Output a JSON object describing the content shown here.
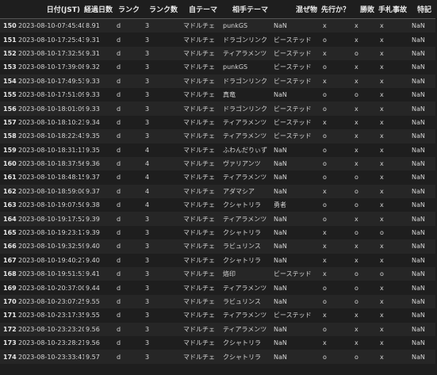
{
  "table": {
    "headers": [
      "",
      "日付(JST)",
      "経過日数",
      "ランク",
      "ランク数",
      "自テーマ",
      "相手テーマ",
      "混ぜ物",
      "先行か？",
      "勝敗",
      "手札事故",
      "特記"
    ],
    "rows": [
      [
        "150",
        "2023-08-10-07:45:40",
        "8.91",
        "d",
        "3",
        "マドルチェ",
        "punkGS",
        "NaN",
        "x",
        "x",
        "x",
        "NaN"
      ],
      [
        "151",
        "2023-08-10-17:25:43",
        "9.31",
        "d",
        "3",
        "マドルチェ",
        "ドラゴンリンク",
        "ビーステッド",
        "o",
        "x",
        "x",
        "NaN"
      ],
      [
        "152",
        "2023-08-10-17:32:50",
        "9.31",
        "d",
        "3",
        "マドルチェ",
        "ティアラメンツ",
        "ビーステッド",
        "x",
        "o",
        "x",
        "NaN"
      ],
      [
        "153",
        "2023-08-10-17:39:08",
        "9.32",
        "d",
        "3",
        "マドルチェ",
        "punkGS",
        "ビーステッド",
        "o",
        "x",
        "x",
        "NaN"
      ],
      [
        "154",
        "2023-08-10-17:49:53",
        "9.33",
        "d",
        "3",
        "マドルチェ",
        "ドラゴンリンク",
        "ビーステッド",
        "x",
        "x",
        "x",
        "NaN"
      ],
      [
        "155",
        "2023-08-10-17:51:09",
        "9.33",
        "d",
        "3",
        "マドルチェ",
        "真竜",
        "NaN",
        "o",
        "o",
        "x",
        "NaN"
      ],
      [
        "156",
        "2023-08-10-18:01:09",
        "9.33",
        "d",
        "3",
        "マドルチェ",
        "ドラゴンリンク",
        "ビーステッド",
        "o",
        "x",
        "x",
        "NaN"
      ],
      [
        "157",
        "2023-08-10-18:10:23",
        "9.34",
        "d",
        "3",
        "マドルチェ",
        "ティアラメンツ",
        "ビーステッド",
        "x",
        "x",
        "x",
        "NaN"
      ],
      [
        "158",
        "2023-08-10-18:22:43",
        "9.35",
        "d",
        "3",
        "マドルチェ",
        "ティアラメンツ",
        "ビーステッド",
        "o",
        "x",
        "x",
        "NaN"
      ],
      [
        "159",
        "2023-08-10-18:31:11",
        "9.35",
        "d",
        "4",
        "マドルチェ",
        "ふわんだりぃず",
        "NaN",
        "o",
        "x",
        "x",
        "NaN"
      ],
      [
        "160",
        "2023-08-10-18:37:56",
        "9.36",
        "d",
        "4",
        "マドルチェ",
        "ヴァリアンツ",
        "NaN",
        "o",
        "x",
        "x",
        "NaN"
      ],
      [
        "161",
        "2023-08-10-18:48:15",
        "9.37",
        "d",
        "4",
        "マドルチェ",
        "ティアラメンツ",
        "NaN",
        "o",
        "o",
        "x",
        "NaN"
      ],
      [
        "162",
        "2023-08-10-18:59:00",
        "9.37",
        "d",
        "4",
        "マドルチェ",
        "アダマシア",
        "NaN",
        "x",
        "o",
        "x",
        "NaN"
      ],
      [
        "163",
        "2023-08-10-19:07:50",
        "9.38",
        "d",
        "4",
        "マドルチェ",
        "クシャトリラ",
        "勇者",
        "o",
        "o",
        "x",
        "NaN"
      ],
      [
        "164",
        "2023-08-10-19:17:52",
        "9.39",
        "d",
        "3",
        "マドルチェ",
        "ティアラメンツ",
        "NaN",
        "o",
        "x",
        "x",
        "NaN"
      ],
      [
        "165",
        "2023-08-10-19:23:17",
        "9.39",
        "d",
        "3",
        "マドルチェ",
        "クシャトリラ",
        "NaN",
        "x",
        "o",
        "o",
        "NaN"
      ],
      [
        "166",
        "2023-08-10-19:32:59",
        "9.40",
        "d",
        "3",
        "マドルチェ",
        "ラビュリンス",
        "NaN",
        "x",
        "x",
        "x",
        "NaN"
      ],
      [
        "167",
        "2023-08-10-19:40:27",
        "9.40",
        "d",
        "3",
        "マドルチェ",
        "クシャトリラ",
        "NaN",
        "x",
        "x",
        "x",
        "NaN"
      ],
      [
        "168",
        "2023-08-10-19:51:53",
        "9.41",
        "d",
        "3",
        "マドルチェ",
        "烙印",
        "ビーステッド",
        "x",
        "o",
        "o",
        "NaN"
      ],
      [
        "169",
        "2023-08-10-20:37:00",
        "9.44",
        "d",
        "3",
        "マドルチェ",
        "ティアラメンツ",
        "NaN",
        "o",
        "o",
        "x",
        "NaN"
      ],
      [
        "170",
        "2023-08-10-23:07:25",
        "9.55",
        "d",
        "3",
        "マドルチェ",
        "ラビュリンス",
        "NaN",
        "o",
        "o",
        "x",
        "NaN"
      ],
      [
        "171",
        "2023-08-10-23:17:35",
        "9.55",
        "d",
        "3",
        "マドルチェ",
        "ティアラメンツ",
        "ビーステッド",
        "x",
        "x",
        "x",
        "NaN"
      ],
      [
        "172",
        "2023-08-10-23:23:20",
        "9.56",
        "d",
        "3",
        "マドルチェ",
        "ティアラメンツ",
        "NaN",
        "o",
        "x",
        "x",
        "NaN"
      ],
      [
        "173",
        "2023-08-10-23:28:21",
        "9.56",
        "d",
        "3",
        "マドルチェ",
        "クシャトリラ",
        "NaN",
        "x",
        "x",
        "x",
        "NaN"
      ],
      [
        "174",
        "2023-08-10-23:33:41",
        "9.57",
        "d",
        "3",
        "マドルチェ",
        "クシャトリラ",
        "NaN",
        "o",
        "o",
        "x",
        "NaN"
      ]
    ]
  }
}
